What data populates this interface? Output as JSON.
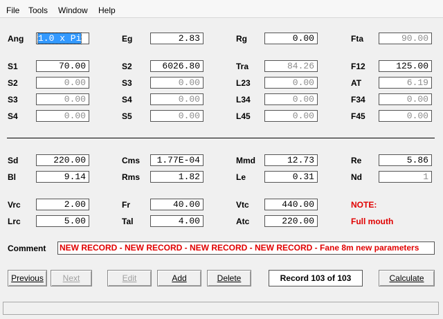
{
  "menu": [
    "File",
    "Tools",
    "Window",
    "Help"
  ],
  "rows": [
    [
      {
        "id": "ang",
        "label": "Ang",
        "value": "1.0 x Pi",
        "selected": true
      },
      {
        "id": "eg",
        "label": "Eg",
        "value": "2.83"
      },
      {
        "id": "rg",
        "label": "Rg",
        "value": "0.00"
      },
      {
        "id": "fta",
        "label": "Fta",
        "value": "90.00",
        "grey": true
      }
    ],
    [
      {
        "id": "s1",
        "label": "S1",
        "value": "70.00"
      },
      {
        "id": "s2b",
        "label": "S2",
        "value": "6026.80"
      },
      {
        "id": "tra",
        "label": "Tra",
        "value": "84.26",
        "grey": true
      },
      {
        "id": "f12",
        "label": "F12",
        "value": "125.00"
      }
    ],
    [
      {
        "id": "s2",
        "label": "S2",
        "value": "0.00",
        "grey": true
      },
      {
        "id": "s3b",
        "label": "S3",
        "value": "0.00",
        "grey": true
      },
      {
        "id": "l23",
        "label": "L23",
        "value": "0.00",
        "grey": true
      },
      {
        "id": "at",
        "label": "AT",
        "value": "6.19",
        "grey": true
      }
    ],
    [
      {
        "id": "s3",
        "label": "S3",
        "value": "0.00",
        "grey": true
      },
      {
        "id": "s4b",
        "label": "S4",
        "value": "0.00",
        "grey": true
      },
      {
        "id": "l34",
        "label": "L34",
        "value": "0.00",
        "grey": true
      },
      {
        "id": "f34",
        "label": "F34",
        "value": "0.00",
        "grey": true
      }
    ],
    [
      {
        "id": "s4",
        "label": "S4",
        "value": "0.00",
        "grey": true
      },
      {
        "id": "s5",
        "label": "S5",
        "value": "0.00",
        "grey": true
      },
      {
        "id": "l45",
        "label": "L45",
        "value": "0.00",
        "grey": true
      },
      {
        "id": "f45",
        "label": "F45",
        "value": "0.00",
        "grey": true
      }
    ],
    [
      {
        "id": "sd",
        "label": "Sd",
        "value": "220.00"
      },
      {
        "id": "cms",
        "label": "Cms",
        "value": "1.77E-04"
      },
      {
        "id": "mmd",
        "label": "Mmd",
        "value": "12.73"
      },
      {
        "id": "re",
        "label": "Re",
        "value": "5.86"
      }
    ],
    [
      {
        "id": "bl",
        "label": "Bl",
        "value": "9.14"
      },
      {
        "id": "rms",
        "label": "Rms",
        "value": "1.82"
      },
      {
        "id": "le",
        "label": "Le",
        "value": "0.31"
      },
      {
        "id": "nd",
        "label": "Nd",
        "value": "1",
        "grey": true
      }
    ],
    [
      {
        "id": "vrc",
        "label": "Vrc",
        "value": "2.00"
      },
      {
        "id": "fr",
        "label": "Fr",
        "value": "40.00"
      },
      {
        "id": "vtc",
        "label": "Vtc",
        "value": "440.00"
      },
      {
        "id": "note",
        "label": "NOTE:",
        "red": true
      }
    ],
    [
      {
        "id": "lrc",
        "label": "Lrc",
        "value": "5.00"
      },
      {
        "id": "tal",
        "label": "Tal",
        "value": "4.00"
      },
      {
        "id": "atc",
        "label": "Atc",
        "value": "220.00"
      },
      {
        "id": "fullmouth",
        "label": "Full mouth",
        "red": true
      }
    ]
  ],
  "comment": {
    "label": "Comment",
    "value": "NEW RECORD - NEW RECORD - NEW RECORD - NEW RECORD - Fane 8m new parameters"
  },
  "buttons": {
    "previous": "Previous",
    "next": "Next",
    "edit": "Edit",
    "add": "Add",
    "delete": "Delete",
    "calculate": "Calculate"
  },
  "record_status": "Record 103 of 103",
  "colors": {
    "note": "#e00000",
    "selection": "#3399ff"
  }
}
